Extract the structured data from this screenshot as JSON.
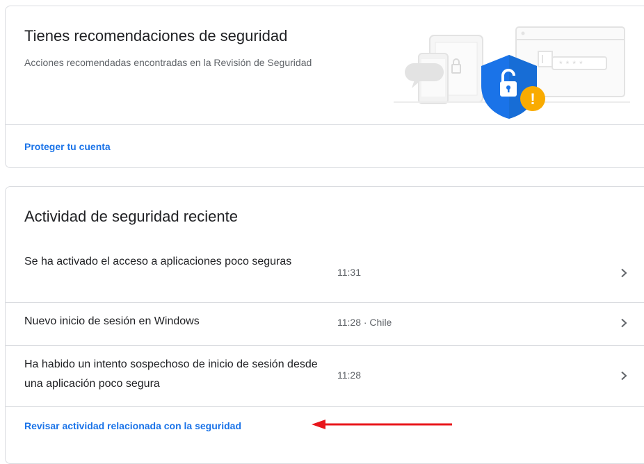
{
  "recommendations_card": {
    "title": "Tienes recomendaciones de seguridad",
    "subtitle": "Acciones recomendadas encontradas en la Revisión de Seguridad",
    "link": "Proteger tu cuenta",
    "illustration_password_mask": "****",
    "illustration_alert_symbol": "!"
  },
  "activity_card": {
    "title": "Actividad de seguridad reciente",
    "events": [
      {
        "text": "Se ha activado el acceso a aplicaciones poco seguras",
        "time": "11:31",
        "chevron": "›"
      },
      {
        "text": "Nuevo inicio de sesión en Windows",
        "time": "11:28 · Chile",
        "chevron": "›"
      },
      {
        "text": "Ha habido un intento sospechoso de inicio de sesión desde una aplicación poco segura",
        "time": "11:28",
        "chevron": "›"
      }
    ],
    "link": "Revisar actividad relacionada con la seguridad"
  },
  "colors": {
    "link": "#1a73e8",
    "shield": "#1a73e8",
    "warning": "#f9ab00",
    "annotation_arrow": "#e8161b",
    "divider": "#dadce0"
  },
  "icons": {
    "shield": "shield-lock-icon",
    "warning": "warning-badge-icon",
    "chevron": "chevron-right-icon",
    "arrow": "red-arrow-annotation"
  }
}
